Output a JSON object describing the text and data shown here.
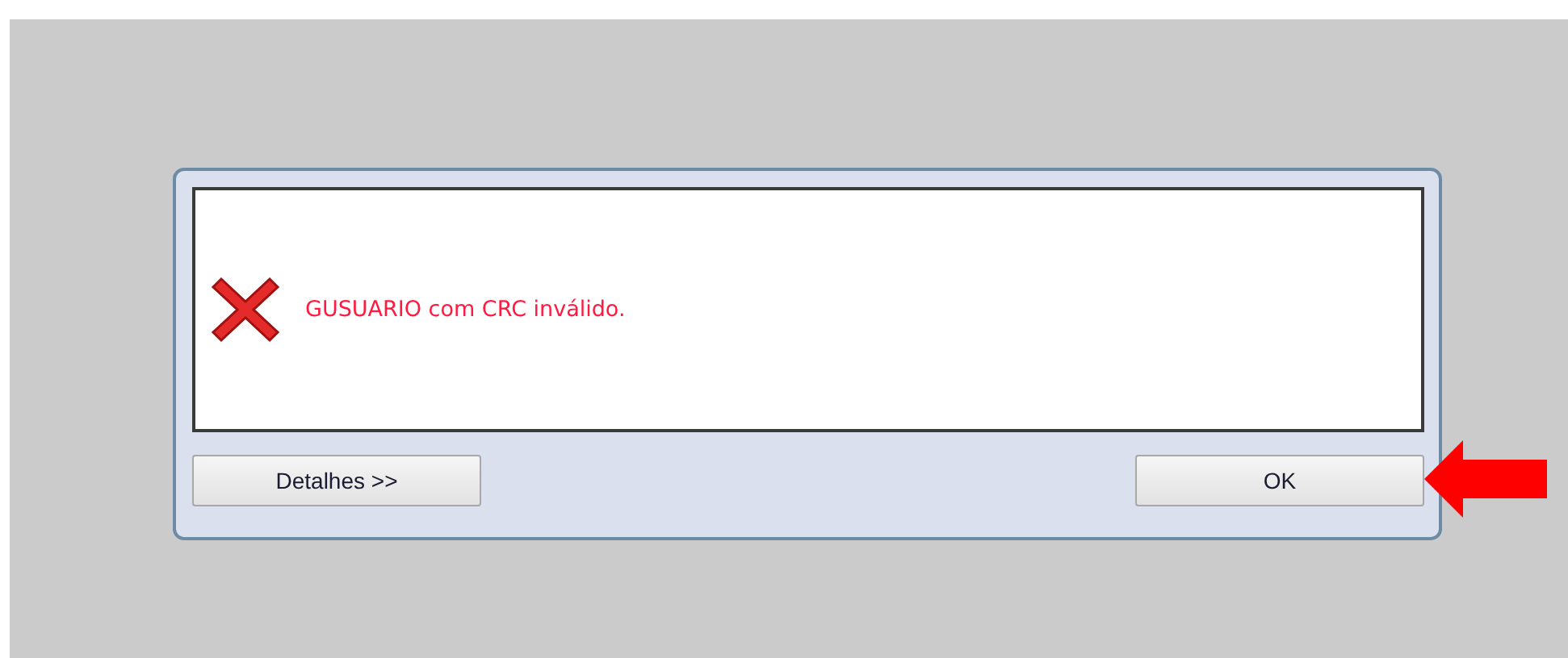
{
  "dialog": {
    "message": "GUSUARIO com CRC inválido.",
    "buttons": [
      {
        "label": "Detalhes >>"
      },
      {
        "label": "OK"
      }
    ]
  }
}
